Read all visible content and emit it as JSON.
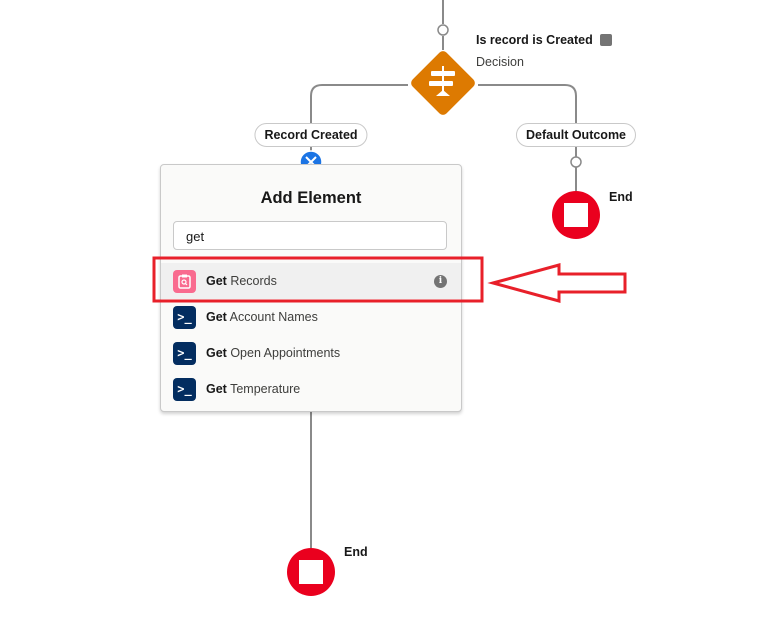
{
  "decision": {
    "name": "Is record is Created",
    "type": "Decision",
    "color": "#dd7a01"
  },
  "outcomes": {
    "left": "Record Created",
    "right": "Default Outcome"
  },
  "end_label_right": "End",
  "end_label_bottom": "End",
  "add_element": {
    "title": "Add Element",
    "search_value": "get",
    "items": [
      {
        "bold": "Get",
        "rest": " Records",
        "icon": "get-records-icon",
        "highlighted": true
      },
      {
        "bold": "Get",
        "rest": " Account Names",
        "icon": "apex-action-icon"
      },
      {
        "bold": "Get",
        "rest": " Open Appointments",
        "icon": "apex-action-icon"
      },
      {
        "bold": "Get",
        "rest": " Temperature",
        "icon": "apex-action-icon"
      }
    ]
  },
  "colors": {
    "end": "#ea001e",
    "close": "#1b74e4",
    "annotation": "#e8202a",
    "apex": "#032d60",
    "records": "#f96b8f"
  }
}
